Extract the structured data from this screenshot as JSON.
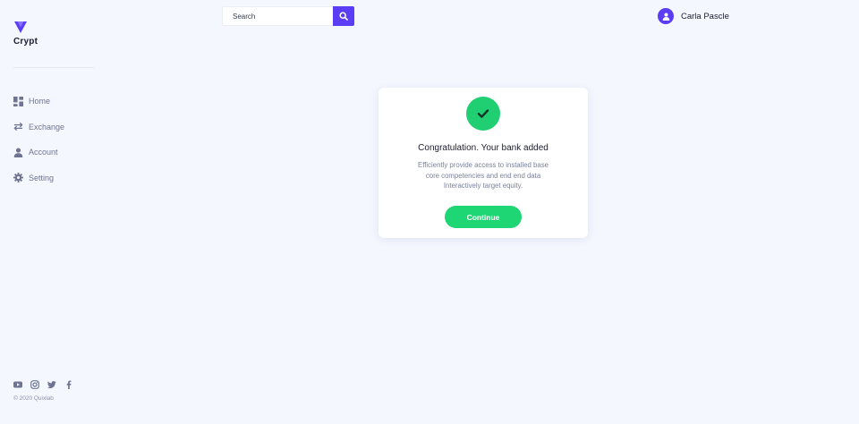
{
  "brand": {
    "name": "Crypt",
    "logo_icon": "triangle-logo-icon",
    "accent_color": "#5b3df5",
    "success_color": "#1fd674"
  },
  "search": {
    "placeholder": "Search",
    "value": "",
    "button_icon": "search-icon"
  },
  "user": {
    "name": "Carla Pascle",
    "avatar_icon": "user-icon"
  },
  "sidebar": {
    "items": [
      {
        "label": "Home",
        "icon": "dashboard-icon"
      },
      {
        "label": "Exchange",
        "icon": "exchange-icon"
      },
      {
        "label": "Account",
        "icon": "user-icon"
      },
      {
        "label": "Setting",
        "icon": "gear-icon"
      }
    ],
    "socials": [
      "youtube-icon",
      "instagram-icon",
      "twitter-icon",
      "facebook-icon"
    ],
    "copyright": "© 2020 Quixlab"
  },
  "modal": {
    "icon": "checkmark-icon",
    "title": "Congratulation. Your bank added",
    "lines": [
      "Efficiently provide access to installed base",
      "core competencies and end end data",
      "Interactively target equity."
    ],
    "button_label": "Continue"
  }
}
